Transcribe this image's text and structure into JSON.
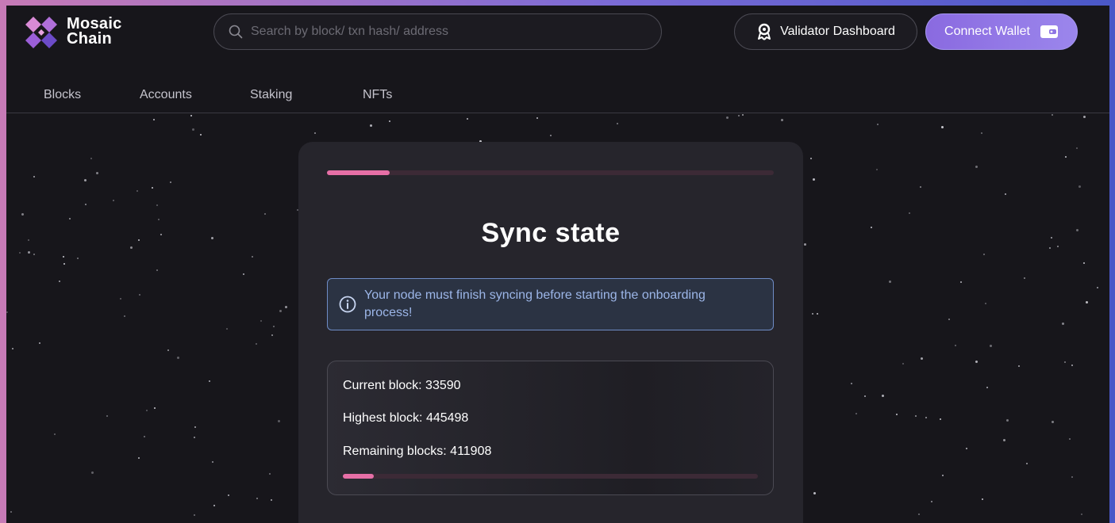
{
  "app": {
    "brand_line1": "Mosaic",
    "brand_line2": "Chain",
    "logo_colors": [
      "#d98ad6",
      "#9b5fd8",
      "#6c4bc8"
    ]
  },
  "search": {
    "placeholder": "Search by block/ txn hash/ address",
    "icon": "search-icon"
  },
  "header": {
    "validator_label": "Validator Dashboard",
    "validator_icon": "validator-badge-icon",
    "wallet_label": "Connect Wallet",
    "wallet_icon": "wallet-icon",
    "accent": "#8a6ae0"
  },
  "nav": {
    "items": [
      {
        "label": "Blocks"
      },
      {
        "label": "Accounts"
      },
      {
        "label": "Staking"
      },
      {
        "label": "NFTs"
      }
    ]
  },
  "sync": {
    "title": "Sync state",
    "step_progress": 0.14,
    "notice": "Your node must finish syncing before starting the onboarding process!",
    "notice_icon": "info-icon",
    "current_label": "Current block: ",
    "current_value": "33590",
    "highest_label": "Highest block: ",
    "highest_value": "445498",
    "remaining_label": "Remaining blocks: ",
    "remaining_value": "411908",
    "sync_progress": 0.075,
    "progress_color": "#e66fa6"
  }
}
